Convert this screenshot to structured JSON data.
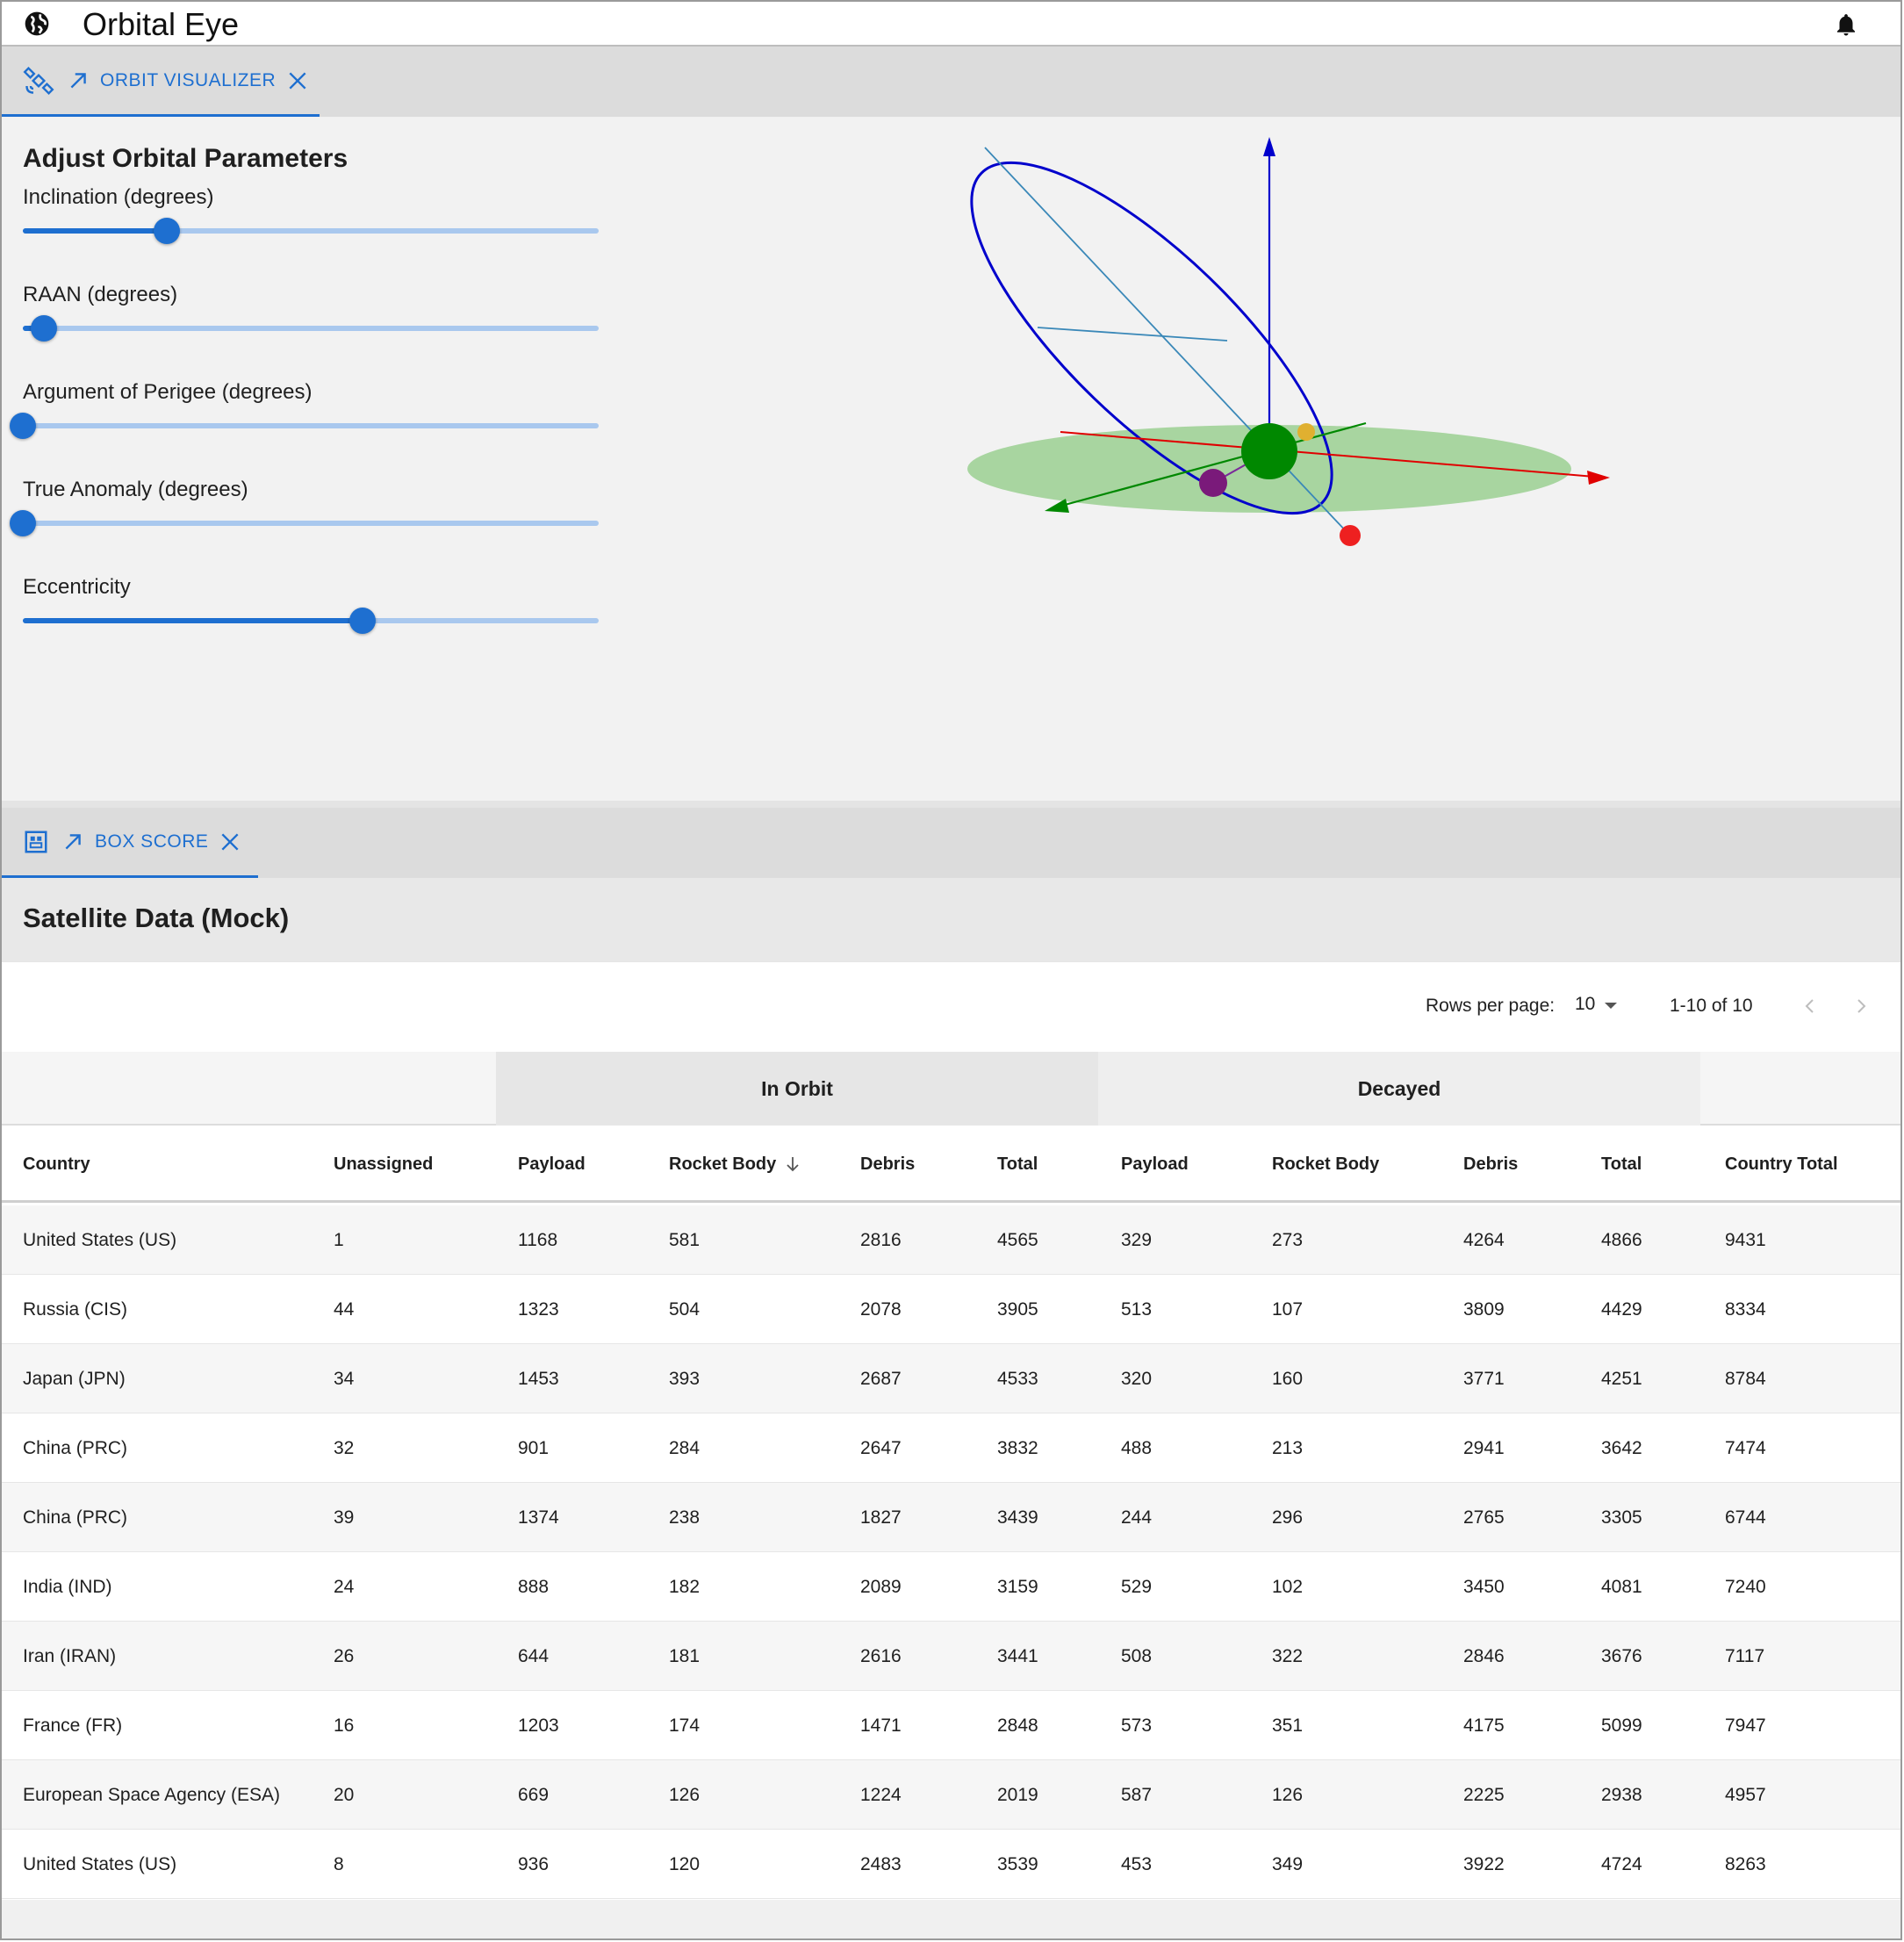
{
  "app": {
    "title": "Orbital Eye",
    "logo_icon": "globe-icon",
    "notification_icon": "bell-icon"
  },
  "orbit_tab": {
    "label": "ORBIT VISUALIZER",
    "icon": "satellite-icon"
  },
  "orbit_panel": {
    "heading": "Adjust Orbital Parameters",
    "sliders": [
      {
        "label": "Inclination (degrees)",
        "value_fraction": 0.25
      },
      {
        "label": "RAAN (degrees)",
        "value_fraction": 0.037
      },
      {
        "label": "Argument of Perigee (degrees)",
        "value_fraction": 0.0
      },
      {
        "label": "True Anomaly (degrees)",
        "value_fraction": 0.0
      },
      {
        "label": "Eccentricity",
        "value_fraction": 0.59
      }
    ]
  },
  "box_tab": {
    "label": "BOX SCORE",
    "icon": "table-icon"
  },
  "box_score": {
    "heading": "Satellite Data (Mock)",
    "pagination": {
      "rows_per_page_label": "Rows per page:",
      "rows_per_page": "10",
      "range": "1-10 of 10"
    },
    "groups": {
      "in_orbit": "In Orbit",
      "decayed": "Decayed"
    },
    "columns": [
      "Country",
      "Unassigned",
      "Payload",
      "Rocket Body",
      "Debris",
      "Total",
      "Payload",
      "Rocket Body",
      "Debris",
      "Total",
      "Country Total"
    ],
    "rows": [
      [
        "United States (US)",
        "1",
        "1168",
        "581",
        "2816",
        "4565",
        "329",
        "273",
        "4264",
        "4866",
        "9431"
      ],
      [
        "Russia (CIS)",
        "44",
        "1323",
        "504",
        "2078",
        "3905",
        "513",
        "107",
        "3809",
        "4429",
        "8334"
      ],
      [
        "Japan (JPN)",
        "34",
        "1453",
        "393",
        "2687",
        "4533",
        "320",
        "160",
        "3771",
        "4251",
        "8784"
      ],
      [
        "China (PRC)",
        "32",
        "901",
        "284",
        "2647",
        "3832",
        "488",
        "213",
        "2941",
        "3642",
        "7474"
      ],
      [
        "China (PRC)",
        "39",
        "1374",
        "238",
        "1827",
        "3439",
        "244",
        "296",
        "2765",
        "3305",
        "6744"
      ],
      [
        "India (IND)",
        "24",
        "888",
        "182",
        "2089",
        "3159",
        "529",
        "102",
        "3450",
        "4081",
        "7240"
      ],
      [
        "Iran (IRAN)",
        "26",
        "644",
        "181",
        "2616",
        "3441",
        "508",
        "322",
        "2846",
        "3676",
        "7117"
      ],
      [
        "France (FR)",
        "16",
        "1203",
        "174",
        "1471",
        "2848",
        "573",
        "351",
        "4175",
        "5099",
        "7947"
      ],
      [
        "European Space Agency (ESA)",
        "20",
        "669",
        "126",
        "1224",
        "2019",
        "587",
        "126",
        "2225",
        "2938",
        "4957"
      ],
      [
        "United States (US)",
        "8",
        "936",
        "120",
        "2483",
        "3539",
        "453",
        "349",
        "3922",
        "4724",
        "8263"
      ]
    ]
  },
  "colors": {
    "accent": "#1e6fd0",
    "orbit": "#0000cc",
    "planet": "#008800",
    "plane": "#a8d5a0"
  }
}
